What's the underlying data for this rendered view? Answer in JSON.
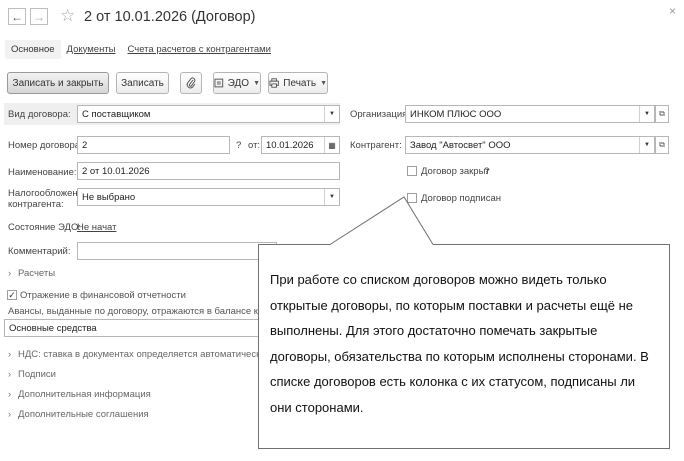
{
  "header": {
    "title": "2 от 10.01.2026 (Договор)",
    "back_icon": "←",
    "forward_icon": "→",
    "star_icon": "☆"
  },
  "tabs": [
    {
      "label": "Основное"
    },
    {
      "label": "Документы"
    },
    {
      "label": "Счета расчетов с контрагентами"
    }
  ],
  "toolbar": {
    "save_close": "Записать и закрыть",
    "save": "Записать",
    "edo": "ЭДО",
    "print": "Печать"
  },
  "form": {
    "contract_type": {
      "label": "Вид договора:",
      "value": "С поставщиком"
    },
    "contract_number": {
      "label": "Номер договора:",
      "value": "2"
    },
    "question_mark": "?",
    "date_from": {
      "label": "от:",
      "value": "10.01.2026"
    },
    "name": {
      "label": "Наименование:",
      "value": "2 от 10.01.2026"
    },
    "taxation": {
      "label": "Налогообложение контрагента:",
      "value": "Не выбрано"
    },
    "edo_state": {
      "label": "Состояние ЭДО:",
      "value": "Не начат"
    },
    "comment": {
      "label": "Комментарий:",
      "value": ""
    },
    "organization": {
      "label": "Организация:",
      "value": "ИНКОМ ПЛЮС ООО"
    },
    "counterparty": {
      "label": "Контрагент:",
      "value": "Завод \"Автосвет\" ООО"
    },
    "closed": {
      "label": "Договор закрыт",
      "hint": "?"
    },
    "signed": {
      "label": "Договор подписан"
    }
  },
  "sections": {
    "payments": "Расчеты",
    "fin_report": "Отражение в финансовой отчетности",
    "advances_label": "Авансы, выданные по договору, отражаются в балансе как:",
    "advances_value": "Основные средства",
    "vat": "НДС: ставка в документах определяется автоматически",
    "signatures": "Подписи",
    "additional_info": "Дополнительная информация",
    "additional_agreements": "Дополнительные соглашения"
  },
  "callout": {
    "text": "При работе со списком договоров можно видеть только открытые договоры, по которым поставки и расчеты ещё не выполнены. Для этого достаточно помечать закрытые договоры, обязательства по которым исполнены сторонами. В списке договоров есть колонка с их статусом, подписаны ли они сторонами."
  }
}
